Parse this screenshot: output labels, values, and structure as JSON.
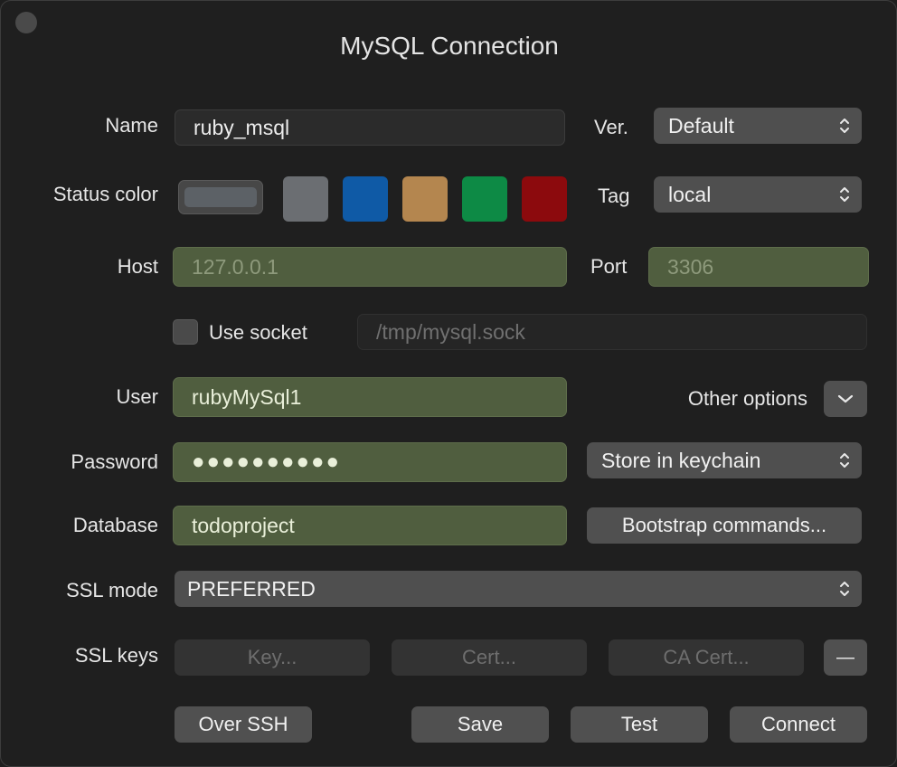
{
  "window": {
    "title": "MySQL Connection"
  },
  "form": {
    "name_label": "Name",
    "name_value": "ruby_msql",
    "version_label": "Ver.",
    "version_value": "Default",
    "status_color_label": "Status color",
    "status_colors": [
      "#5c6166",
      "#6b6e72",
      "#0f5aa6",
      "#b4864f",
      "#0d8a45",
      "#8c0a0d"
    ],
    "tag_label": "Tag",
    "tag_value": "local",
    "host_label": "Host",
    "host_placeholder": "127.0.0.1",
    "port_label": "Port",
    "port_placeholder": "3306",
    "use_socket_label": "Use socket",
    "socket_placeholder": "/tmp/mysql.sock",
    "user_label": "User",
    "user_value": "rubyMySql1",
    "other_options_label": "Other options",
    "password_label": "Password",
    "password_mask": "●●●●●●●●●●",
    "password_storage": "Store in keychain",
    "database_label": "Database",
    "database_value": "todoproject",
    "bootstrap_label": "Bootstrap commands...",
    "ssl_mode_label": "SSL mode",
    "ssl_mode_value": "PREFERRED",
    "ssl_keys_label": "SSL keys",
    "key_button": "Key...",
    "cert_button": "Cert...",
    "ca_cert_button": "CA Cert...",
    "remove_button": "—"
  },
  "footer": {
    "over_ssh": "Over SSH",
    "save": "Save",
    "test": "Test",
    "connect": "Connect"
  }
}
